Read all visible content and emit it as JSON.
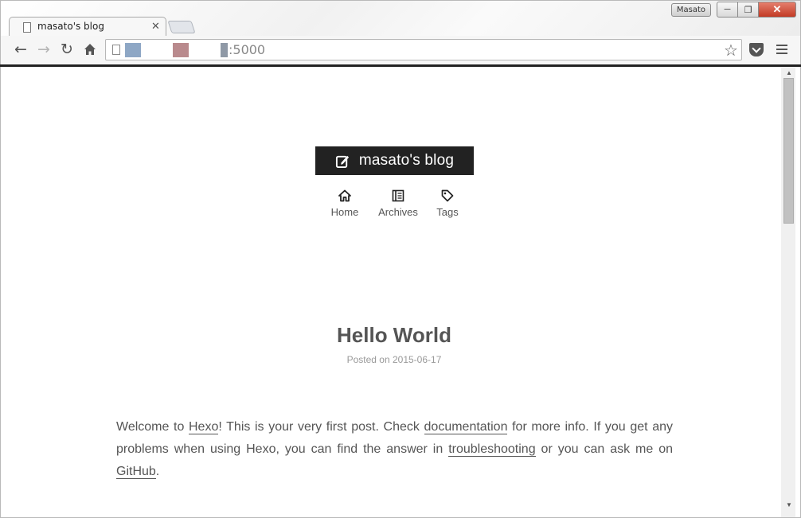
{
  "browser": {
    "profile_name": "Masato",
    "tab": {
      "title": "masato's blog"
    },
    "address": {
      "suffix": ":5000"
    }
  },
  "blog": {
    "site_title": "masato's blog",
    "nav": [
      {
        "label": "Home",
        "icon": "home-icon"
      },
      {
        "label": "Archives",
        "icon": "archive-icon"
      },
      {
        "label": "Tags",
        "icon": "tag-icon"
      }
    ],
    "post": {
      "title": "Hello World",
      "meta_prefix": "Posted on ",
      "date": "2015-06-17",
      "body": {
        "t1": "Welcome to ",
        "link_hexo": "Hexo",
        "t2": "! This is your very first post. Check ",
        "link_docs": "documentation",
        "t3": " for more info. If you get any problems when using Hexo, you can find the answer in ",
        "link_trouble": "troubleshooting",
        "t4": " or you can ask me on ",
        "link_github": "GitHub",
        "t5": "."
      }
    }
  },
  "colors": {
    "logo_bg": "#222222",
    "text": "#555555",
    "meta": "#999999",
    "close_button": "#c23a25"
  }
}
